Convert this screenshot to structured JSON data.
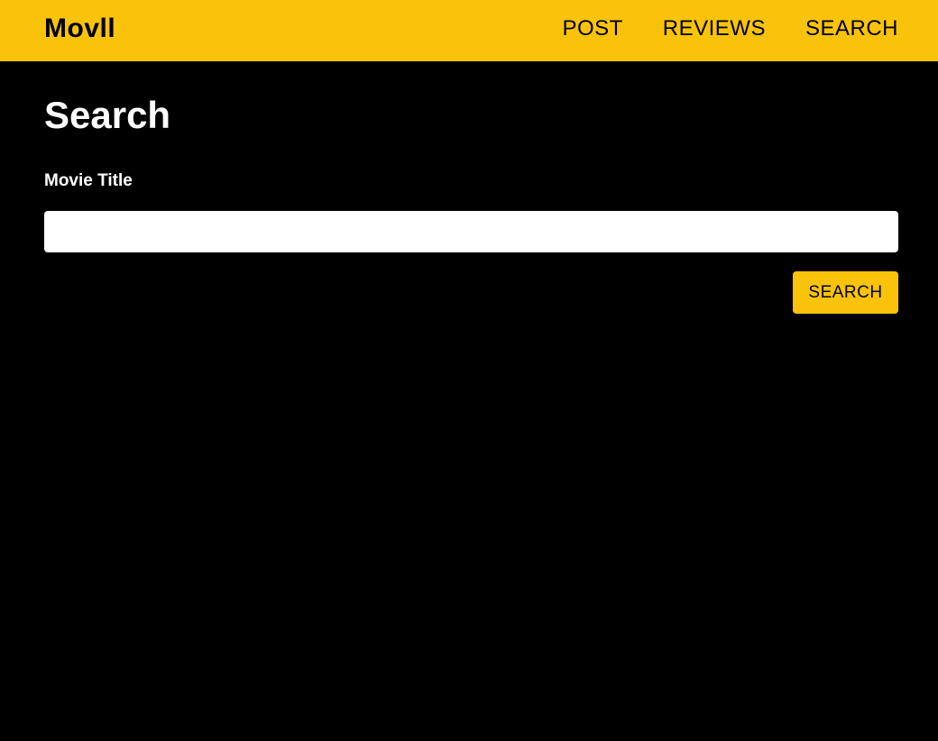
{
  "navbar": {
    "brand": "Movll",
    "links": [
      "POST",
      "REVIEWS",
      "SEARCH"
    ],
    "background_color": "#f9c30b"
  },
  "main": {
    "title": "Search",
    "form": {
      "label": "Movie Title",
      "input_value": "",
      "input_placeholder": "",
      "submit_label": "SEARCH"
    }
  },
  "colors": {
    "accent": "#f9c30b",
    "background": "#000000",
    "text": "#ffffff"
  }
}
